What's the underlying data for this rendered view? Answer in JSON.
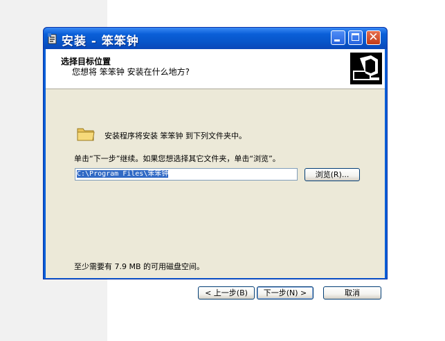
{
  "window": {
    "title": "安装 - 笨笨钟"
  },
  "header": {
    "title": "选择目标位置",
    "subtitle": "您想将 笨笨钟 安装在什么地方?"
  },
  "body": {
    "install_text": "安装程序将安装 笨笨钟 到下列文件夹中。",
    "next_text": "单击“下一步”继续。如果您想选择其它文件夹，单击“浏览”。",
    "path_value": "C:\\Program Files\\笨笨钟",
    "browse_label": "浏览(R)...",
    "space_text": "至少需要有 7.9 MB 的可用磁盘空间。"
  },
  "footer": {
    "back_label": "< 上一步(B)",
    "next_label": "下一步(N) >",
    "cancel_label": "取消"
  },
  "colors": {
    "titlebar": "#0a5fd8",
    "dialog_bg": "#ece9d8",
    "selection": "#316ac5"
  }
}
